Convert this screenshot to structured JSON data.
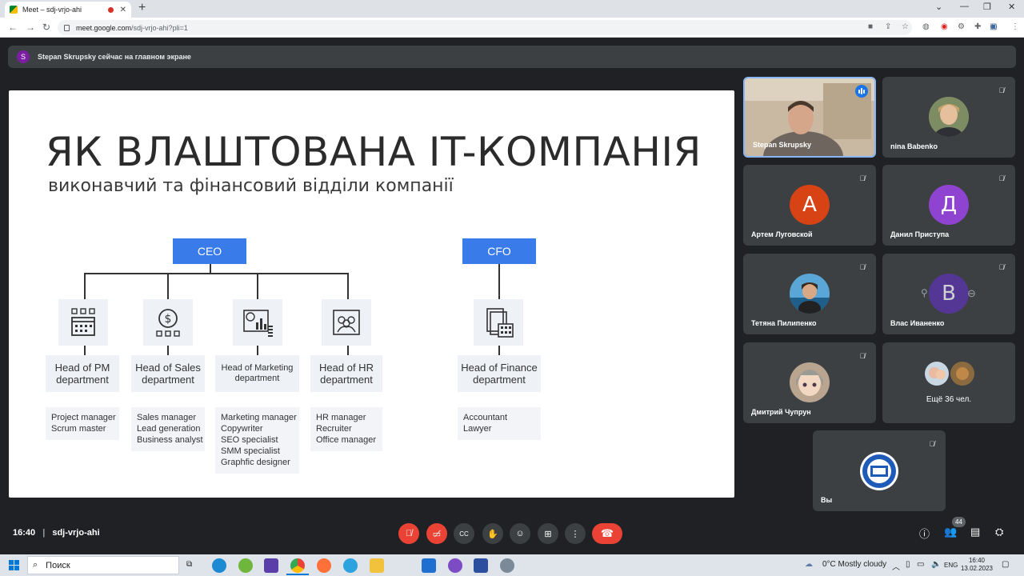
{
  "browser": {
    "tab_title": "Meet – sdj-vrjo-ahi",
    "tab_close": "✕",
    "new_tab": "+",
    "url_host": "meet.google.com",
    "url_path": "/sdj-vrjo-ahi?pli=1",
    "window_controls": [
      "⌄",
      "—",
      "❐",
      "✕"
    ]
  },
  "presenter": {
    "initial": "S",
    "text": "Stepan Skrupsky сейчас на главном экране"
  },
  "slide": {
    "title": "ЯК ВЛАШТОВАНА IT-КОМПАНІЯ",
    "subtitle": "виконавчий та фінансовий відділи компанії",
    "ceo": "CEO",
    "cfo": "CFO",
    "departments": [
      {
        "head": [
          "Head of PM",
          "department"
        ],
        "roles": [
          "Project manager",
          "Scrum master"
        ],
        "icon": "calendar-icon"
      },
      {
        "head": [
          "Head of Sales",
          "department"
        ],
        "roles": [
          "Sales manager",
          "Lead generation",
          "Business analyst"
        ],
        "icon": "dollar-icon"
      },
      {
        "head": [
          "Head of Marketing",
          "department"
        ],
        "roles": [
          "Marketing manager",
          "Copywriter",
          "SEO specialist",
          "SMM specialist",
          "Graphfic designer"
        ],
        "icon": "chart-icon"
      },
      {
        "head": [
          "Head of HR",
          "department"
        ],
        "roles": [
          "HR manager",
          "Recruiter",
          "Office manager"
        ],
        "icon": "people-icon"
      },
      {
        "head": [
          "Head of Finance",
          "department"
        ],
        "roles": [
          "Accountant",
          "Lawyer"
        ],
        "icon": "calculator-icon"
      }
    ]
  },
  "participants": [
    {
      "name": "Stepan Skrupsky",
      "type": "video",
      "speaking": true
    },
    {
      "name": "nina Babenko",
      "type": "photo",
      "muted": true
    },
    {
      "name": "Артем Луговской",
      "type": "letter",
      "initial": "А",
      "color": "#d84315",
      "muted": true
    },
    {
      "name": "Данил Приступа",
      "type": "letter",
      "initial": "Д",
      "color": "#8e44d0",
      "muted": true
    },
    {
      "name": "Тетяна Пилипенко",
      "type": "photo",
      "muted": true
    },
    {
      "name": "Влас Иваненко",
      "type": "letter",
      "initial": "В",
      "color": "#5c35b0",
      "muted": true
    },
    {
      "name": "Дмитрий Чупрун",
      "type": "photo",
      "muted": true
    },
    {
      "name": "",
      "type": "more",
      "more_text": "Ещё 36 чел."
    },
    {
      "name": "Вы",
      "type": "logo",
      "muted": true
    }
  ],
  "controls": {
    "time": "16:40",
    "meeting_code": "sdj-vrjo-ahi",
    "participants_count": "44"
  },
  "taskbar": {
    "search_placeholder": "Поиск",
    "weather": "0°C  Mostly cloudy",
    "language": "ENG",
    "time": "16:40",
    "date": "13.02.2023"
  },
  "colors": {
    "meet_bg": "#202124",
    "tile_bg": "#3c4043",
    "slide_accent": "#3a7bea",
    "end_call": "#ea4335"
  }
}
